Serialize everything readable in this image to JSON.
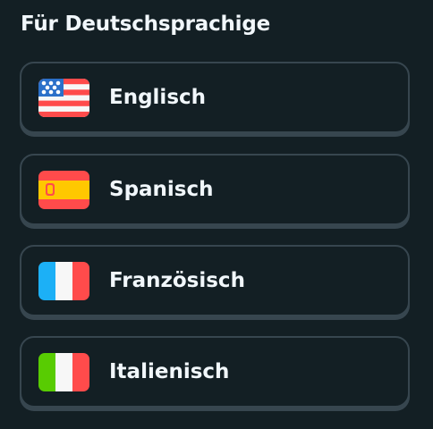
{
  "section": {
    "title": "Für Deutschsprachige"
  },
  "languages": [
    {
      "label": "Englisch",
      "flag": "us-flag-icon"
    },
    {
      "label": "Spanisch",
      "flag": "spain-flag-icon"
    },
    {
      "label": "Französisch",
      "flag": "france-flag-icon"
    },
    {
      "label": "Italienisch",
      "flag": "italy-flag-icon"
    }
  ],
  "colors": {
    "background": "#131f24",
    "card_border": "#37464f",
    "text": "#f1f7fb"
  }
}
